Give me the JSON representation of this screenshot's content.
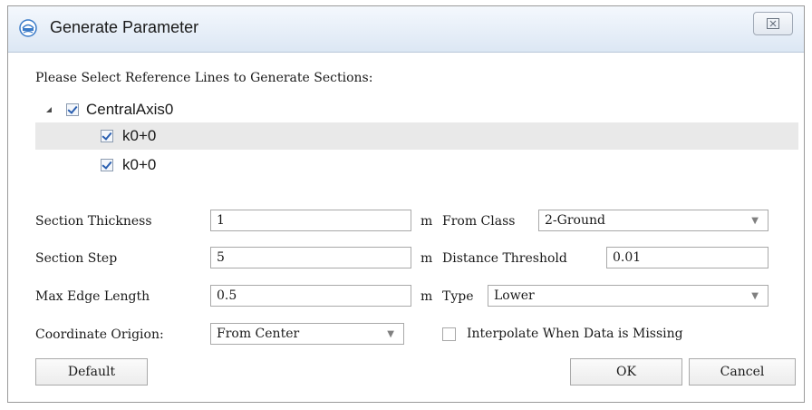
{
  "window": {
    "title": "Generate Parameter",
    "close_glyph": "⌧"
  },
  "prompt": "Please Select Reference Lines to Generate Sections:",
  "tree": {
    "root_label": "CentralAxis0",
    "children": [
      "k0+0",
      "k0+0"
    ]
  },
  "fields": {
    "section_thickness": {
      "label": "Section Thickness",
      "value": "1",
      "unit": "m"
    },
    "section_step": {
      "label": "Section Step",
      "value": "5",
      "unit": "m"
    },
    "max_edge_length": {
      "label": "Max Edge Length",
      "value": "0.5",
      "unit": "m"
    },
    "coordinate_origin": {
      "label": "Coordinate Origion:",
      "value": "From Center"
    },
    "from_class": {
      "label": "From Class",
      "value": "2-Ground"
    },
    "distance_threshold": {
      "label": "Distance Threshold",
      "value": "0.01"
    },
    "type": {
      "label": "Type",
      "value": "Lower"
    },
    "interpolate": {
      "label": "Interpolate When Data is Missing",
      "checked": false
    }
  },
  "buttons": {
    "default": "Default",
    "ok": "OK",
    "cancel": "Cancel"
  },
  "colors": {
    "titlebar": "#dce7f4",
    "check": "#2a5fb0",
    "row_highlight": "#e9e9e9"
  }
}
